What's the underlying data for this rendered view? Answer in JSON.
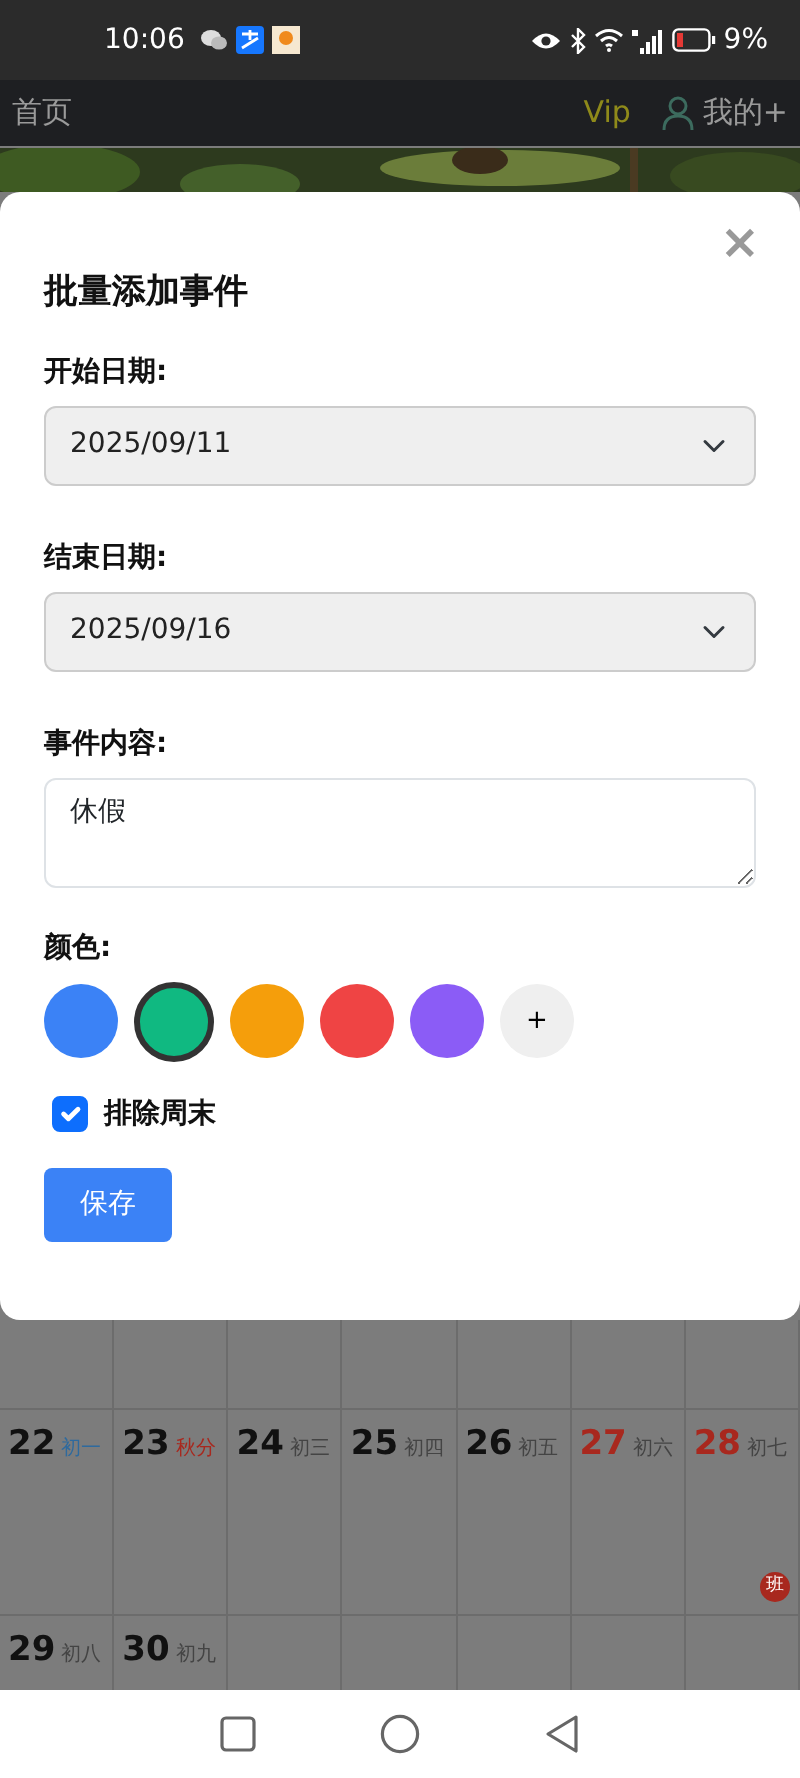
{
  "status_bar": {
    "time": "10:06",
    "battery": "9%"
  },
  "app_bar": {
    "home": "首页",
    "vip": "Vip",
    "account": "我的+"
  },
  "modal": {
    "title": "批量添加事件",
    "close": "×",
    "start_label": "开始日期:",
    "start_value": "2025/09/11",
    "end_label": "结束日期:",
    "end_value": "2025/09/16",
    "content_label": "事件内容:",
    "content_value": "休假",
    "color_label": "颜色:",
    "colors": [
      {
        "color": "#3b82f6",
        "selected": false
      },
      {
        "color": "#10b981",
        "selected": true
      },
      {
        "color": "#f59e0b",
        "selected": false
      },
      {
        "color": "#ef4444",
        "selected": false
      },
      {
        "color": "#8b5cf6",
        "selected": false
      }
    ],
    "add_color": "+",
    "exclude_weekend": {
      "label": "排除周末",
      "checked": true
    },
    "save": "保存"
  },
  "calendar": {
    "weeks": [
      {
        "days": [
          {
            "day": "22",
            "lunar": {
              "text": "初一",
              "color": "#2e6a9e"
            },
            "weekend": false
          },
          {
            "day": "23",
            "lunar": {
              "text": "秋分",
              "color": "#a8281e"
            },
            "weekend": false
          },
          {
            "day": "24",
            "lunar": {
              "text": "初三",
              "color": "#444444"
            },
            "weekend": false
          },
          {
            "day": "25",
            "lunar": {
              "text": "初四",
              "color": "#444444"
            },
            "weekend": false
          },
          {
            "day": "26",
            "lunar": {
              "text": "初五",
              "color": "#444444"
            },
            "weekend": false
          },
          {
            "day": "27",
            "lunar": {
              "text": "初六",
              "color": "#444444"
            },
            "weekend": true
          },
          {
            "day": "28",
            "lunar": {
              "text": "初七",
              "color": "#444444"
            },
            "weekend": true,
            "badge": "班"
          }
        ]
      },
      {
        "days": [
          {
            "day": "29",
            "lunar": {
              "text": "初八",
              "color": "#444444"
            },
            "weekend": false
          },
          {
            "day": "30",
            "lunar": {
              "text": "初九",
              "color": "#444444"
            },
            "weekend": false
          }
        ]
      }
    ]
  }
}
